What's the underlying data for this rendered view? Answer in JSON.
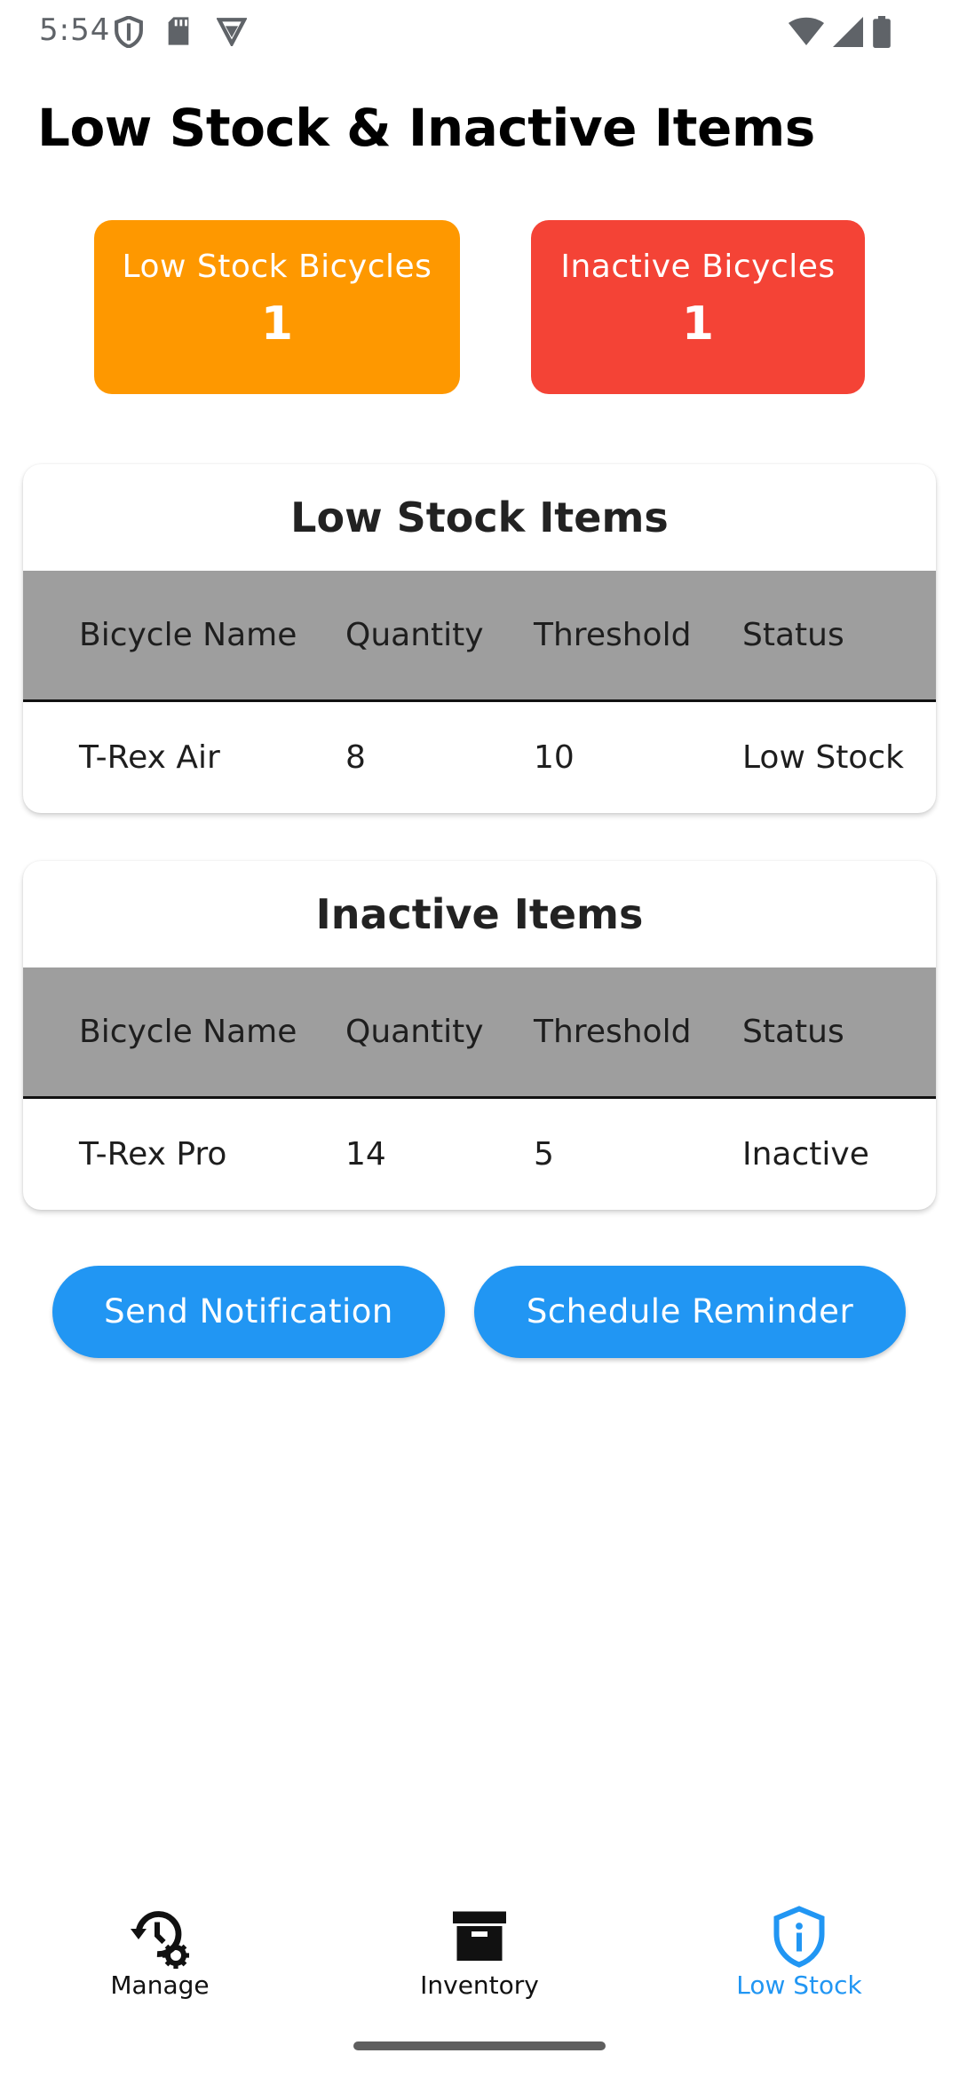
{
  "status_bar": {
    "time": "5:54",
    "left_icons": [
      "shield-icon",
      "sd-card-icon",
      "vpn-key-icon"
    ],
    "right_icons": [
      "wifi-icon",
      "signal-icon",
      "battery-icon"
    ]
  },
  "page_title": "Low Stock & Inactive Items",
  "summary": {
    "low_stock": {
      "label": "Low Stock Bicycles",
      "count": "1",
      "color": "#fe9800"
    },
    "inactive": {
      "label": "Inactive Bicycles",
      "count": "1",
      "color": "#f44336"
    }
  },
  "low_stock_table": {
    "title": "Low Stock Items",
    "columns": [
      "Bicycle Name",
      "Quantity",
      "Threshold",
      "Status"
    ],
    "rows": [
      {
        "name": "T-Rex Air",
        "quantity": "8",
        "threshold": "10",
        "status": "Low Stock"
      }
    ]
  },
  "inactive_table": {
    "title": "Inactive Items",
    "columns": [
      "Bicycle Name",
      "Quantity",
      "Threshold",
      "Status"
    ],
    "rows": [
      {
        "name": "T-Rex Pro",
        "quantity": "14",
        "threshold": "5",
        "status": "Inactive"
      }
    ]
  },
  "actions": {
    "send_notification": "Send Notification",
    "schedule_reminder": "Schedule Reminder"
  },
  "bottom_nav": {
    "items": [
      {
        "label": "Manage",
        "icon": "manage-history-icon",
        "active": false
      },
      {
        "label": "Inventory",
        "icon": "archive-box-icon",
        "active": false
      },
      {
        "label": "Low Stock",
        "icon": "shield-info-icon",
        "active": true
      }
    ],
    "active_color": "#2196f3"
  },
  "colors": {
    "accent": "#2196f3",
    "table_header": "#9e9e9e"
  }
}
